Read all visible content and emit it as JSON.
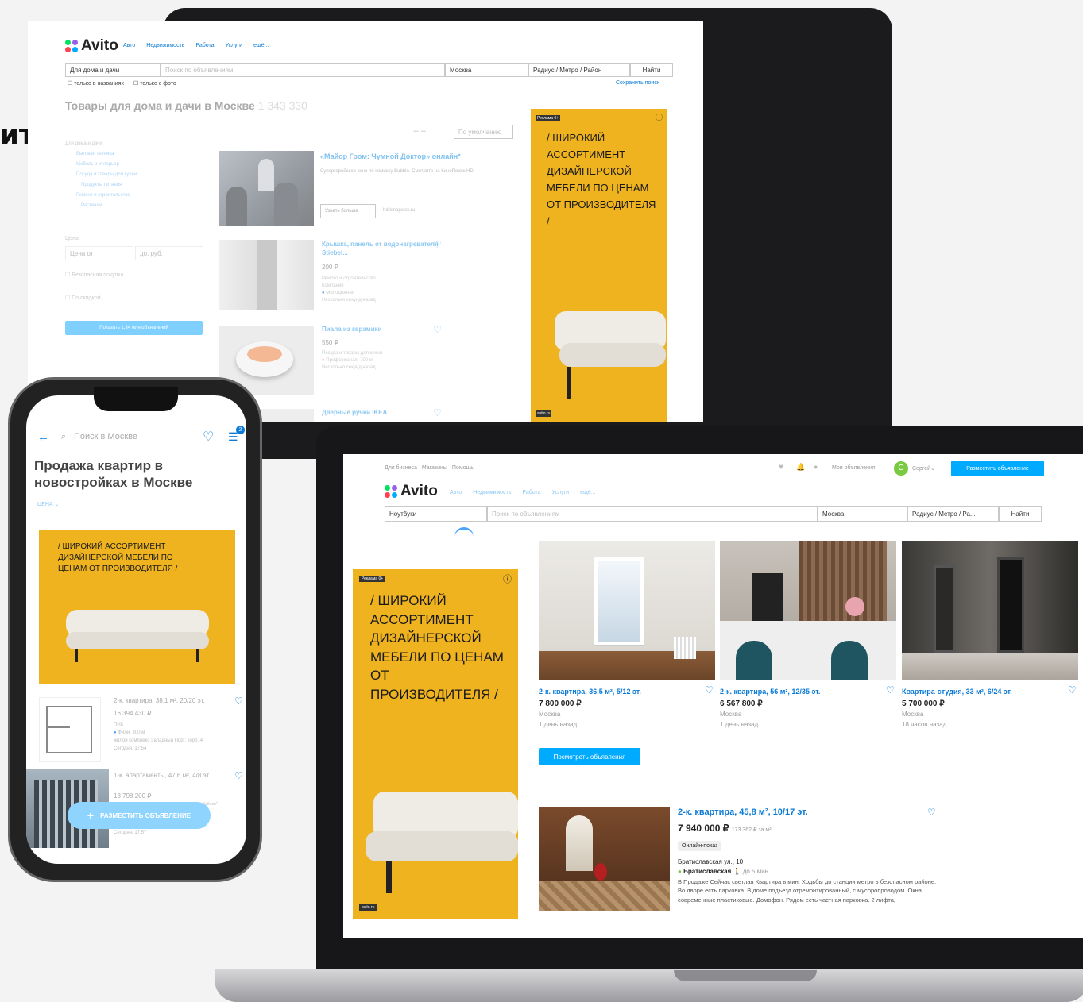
{
  "left_heading": "ито",
  "monitor": {
    "logo": "Avito",
    "nav": [
      "Авто",
      "Недвижимость",
      "Работа",
      "Услуги",
      "ещё..."
    ],
    "category_select": "Для дома и дачи",
    "search_placeholder": "Поиск по объявлениям",
    "location": "Москва",
    "radius": "Радиус / Метро / Район",
    "find": "Найти",
    "opt_titles": "только в названиях",
    "opt_photo": "только с фото",
    "save_search": "Сохранить поиск",
    "title": "Товары для дома и дачи в Москве",
    "count": "1 343 330",
    "sort": "По умолчанию",
    "categories": [
      "Для дома и дачи",
      "Бытовая техника",
      "Мебель и интерьер",
      "Посуда и товары для кухни",
      "Продукты питания",
      "Ремонт и строительство",
      "Растения"
    ],
    "price_label": "Цена",
    "price_from": "Цена от",
    "price_to": "до, руб.",
    "safe_buy": "Безопасная покупка",
    "discount": "Со скидкой",
    "show_btn": "Показать 1,34 млн объявлений",
    "promo_title": "«Майор Гром: Чумной Доктор» онлайн*",
    "promo_desc": "Супергеройское кино по комиксу Bubble. Смотрите на КиноПоиск HD.",
    "promo_more": "Узнать больше",
    "promo_domain": "hd.kinopoisk.ru",
    "items": [
      {
        "title": "Крышка, панель от водонагревателя Stiebel...",
        "price": "200 ₽",
        "cat": "Ремонт и строительство",
        "sub": "Компания",
        "metro": "Молодежная",
        "time": "Несколько секунд назад"
      },
      {
        "title": "Пиала из керамики",
        "price": "550 ₽",
        "cat": "Посуда и товары для кухни",
        "metro": "Профсоюзная, 700 м",
        "time": "Несколько секунд назад"
      },
      {
        "title": "Дверные ручки IKEA"
      }
    ],
    "ad": {
      "badge": "Реклама",
      "age": "0+",
      "text": "/ ШИРОКИЙ АССОРТИМЕНТ ДИЗАЙНЕРСКОЙ МЕБЕЛИ ПО ЦЕНАМ ОТ ПРОИЗВОДИТЕЛЯ /",
      "domain": "avito.ru"
    }
  },
  "laptop": {
    "top_links": [
      "Для бизнеса",
      "Магазины",
      "Помощь"
    ],
    "my_ads": "Мои объявления",
    "user": "Сергей",
    "post_ad": "Разместить объявление",
    "logo": "Avito",
    "nav": [
      "Авто",
      "Недвижимость",
      "Работа",
      "Услуги",
      "ещё..."
    ],
    "category_select": "Ноутбуки",
    "search_placeholder": "Поиск по объявлениям",
    "location": "Москва",
    "radius": "Радиус / Метро / Ра...",
    "find": "Найти",
    "ad": {
      "badge": "Реклама",
      "age": "0+",
      "text": "/ ШИРОКИЙ АССОРТИМЕНТ ДИЗАЙНЕРСКОЙ МЕБЕЛИ ПО ЦЕНАМ ОТ ПРОИЗВОДИТЕЛЯ /",
      "domain": "avito.ru"
    },
    "cards": [
      {
        "title": "2-к. квартира, 36,5 м², 5/12 эт.",
        "price": "7 800 000 ₽",
        "city": "Москва",
        "time": "1 день назад"
      },
      {
        "title": "2-к. квартира, 56 м², 12/35 эт.",
        "price": "6 567 800 ₽",
        "city": "Москва",
        "time": "1 день назад"
      },
      {
        "title": "Квартира-студия, 33 м², 6/24 эт.",
        "price": "5 700 000 ₽",
        "city": "Москва",
        "time": "18 часов назад"
      }
    ],
    "view_ads": "Посмотреть объявления",
    "listing": {
      "title": "2-к. квартира, 45,8 м², 10/17 эт.",
      "price": "7 940 000 ₽",
      "per_m": "173 362 ₽ за м²",
      "badge": "Онлайн-показ",
      "address": "Братиславская ул., 10",
      "metro": "Братиславская",
      "walk": "до 5 мин.",
      "desc": "В Продаже Сейчас светлая Квартира в мин. Ходьбы до станции метро в безопасном районе. Во дворе есть парковка. В доме подъезд отремонтированный, с мусоропроводом. Окна современные пластиковые. Домофон. Рядом есть частная парковка. 2 лифта,"
    }
  },
  "phone": {
    "search_placeholder": "Поиск в Москве",
    "filter_badge": "2",
    "title": "Продажа квартир в новостройках в Москве",
    "price_chip": "ЦЕНА",
    "ad_text": "/ ШИРОКИЙ АССОРТИМЕНТ ДИЗАЙНЕРСКОЙ МЕБЕЛИ ПО ЦЕНАМ ОТ ПРОИЗВОДИТЕЛЯ /",
    "items": [
      {
        "title": "2-к. квартира, 38,1 м², 20/20 эт.",
        "price": "16 394 430 ₽",
        "seller": "ПИК",
        "metro": "Фили, 300 м",
        "complex": "жилой комплекс Западный Порт, корп. 4",
        "time": "Сегодня, 17:54"
      },
      {
        "title": "1-к. апартаменты, 47,6 м², 4/8 эт.",
        "price": "13 798 200 ₽",
        "extra": "Бубнов\"",
        "time": "Сегодня, 17:57"
      }
    ],
    "post_ad": "РАЗМЕСТИТЬ ОБЪЯВЛЕНИЕ"
  },
  "colors": {
    "accent": "#0a7ad6",
    "button": "#00aaff",
    "ad": "#f0b320"
  }
}
